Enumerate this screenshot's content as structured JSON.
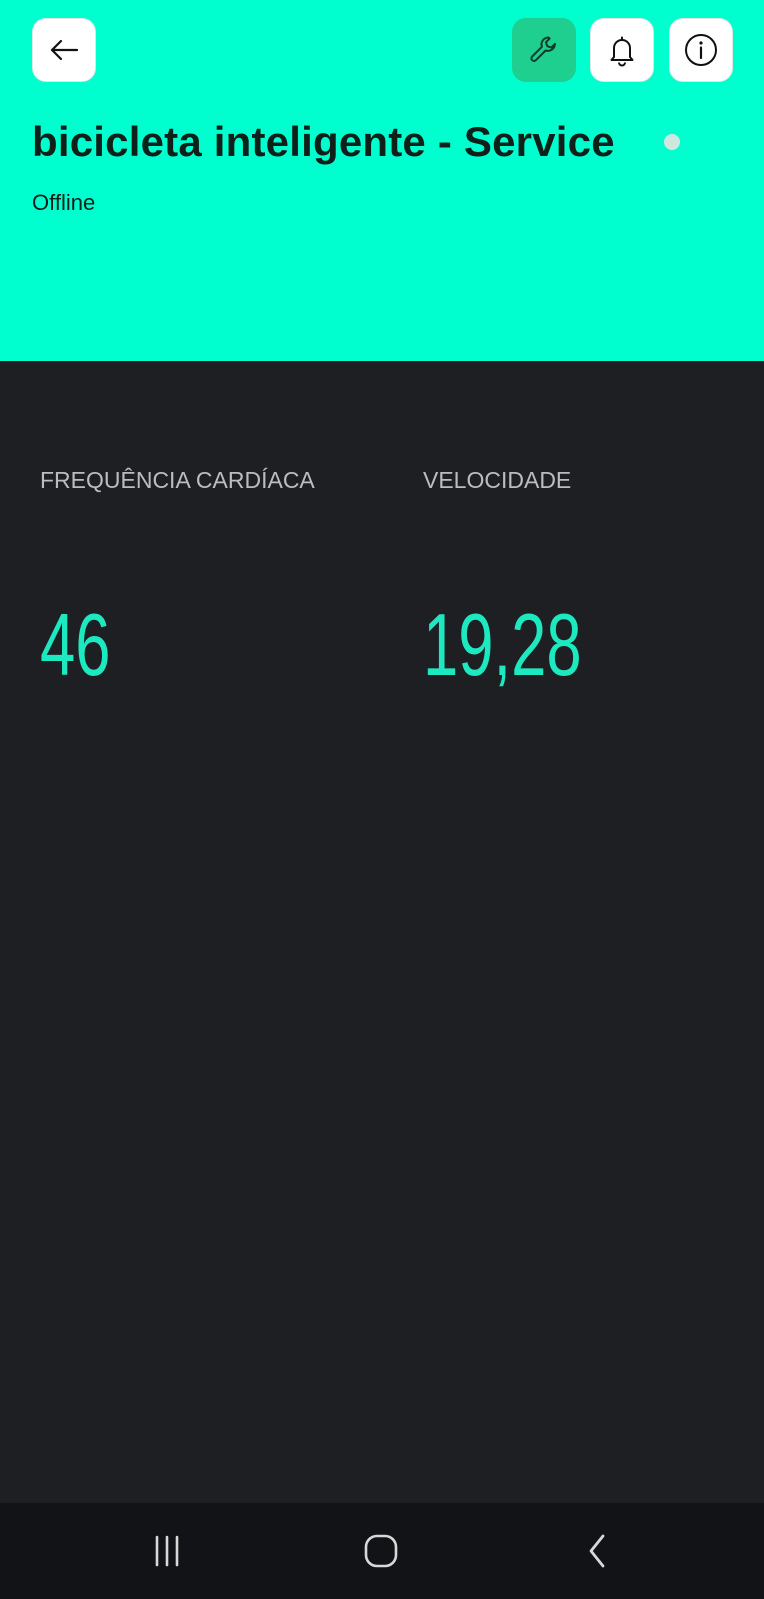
{
  "header": {
    "title": "bicicleta inteligente - Service",
    "status": "Offline",
    "colors": {
      "background": "#00ffcf",
      "active_button": "#1ecf8f",
      "status_dot": "#cfe7df"
    },
    "buttons": {
      "back": "arrow-left-icon",
      "service": "wrench-icon",
      "notifications": "bell-icon",
      "info": "info-icon"
    }
  },
  "widgets": [
    {
      "label": "FREQUÊNCIA CARDÍACA",
      "value": "46"
    },
    {
      "label": "VELOCIDADE",
      "value": "19,28"
    }
  ],
  "colors": {
    "dashboard_background": "#1e1f23",
    "value_accent": "#1de9c0",
    "label": "#b9bdc2"
  },
  "system_nav": {
    "buttons": [
      "recent-apps-icon",
      "home-icon",
      "back-icon"
    ]
  }
}
